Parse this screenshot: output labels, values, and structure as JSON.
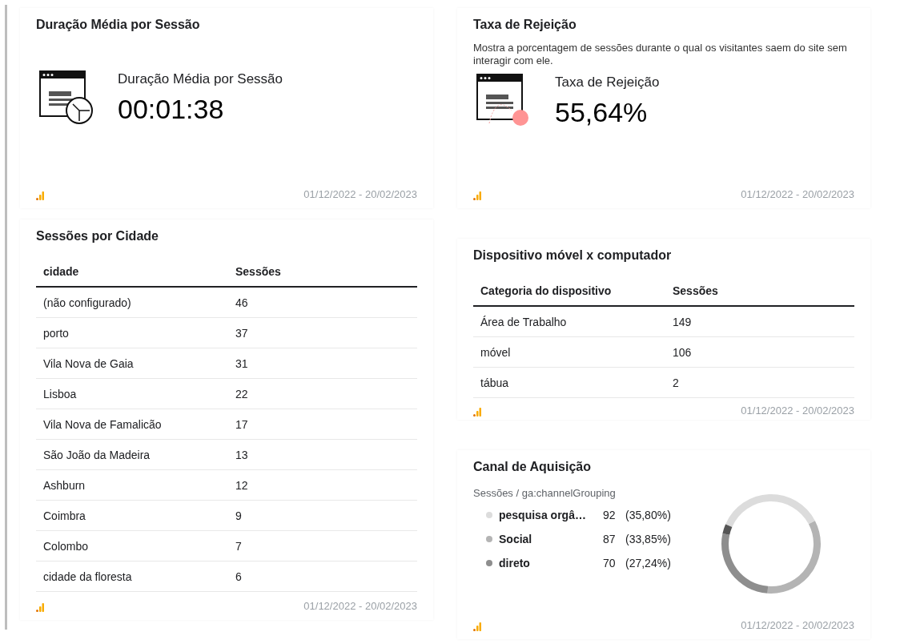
{
  "scorecards": [
    {
      "kind": "clock",
      "title": "Duração Média por Sessão",
      "label": "Duração Média por Sessão",
      "value": "00:01:38",
      "date_range": "01/12/2022 - 20/02/2023"
    },
    {
      "kind": "bounce",
      "title": "Taxa de Rejeição",
      "description": "Mostra a porcentagem de sessões durante o qual os visitantes saem do site sem interagir com ele.",
      "label": "Taxa de Rejeição",
      "value": "55,64%",
      "date_range": "01/12/2022 - 20/02/2023"
    }
  ],
  "city_table": {
    "title": "Sessões por Cidade",
    "columns": [
      "cidade",
      "Sessões"
    ],
    "rows": [
      [
        "(não configurado)",
        "46"
      ],
      [
        "porto",
        "37"
      ],
      [
        "Vila Nova de Gaia",
        "31"
      ],
      [
        "Lisboa",
        "22"
      ],
      [
        "Vila Nova de Famalicão",
        "17"
      ],
      [
        "São João da Madeira",
        "13"
      ],
      [
        "Ashburn",
        "12"
      ],
      [
        "Coimbra",
        "9"
      ],
      [
        "Colombo",
        "7"
      ],
      [
        "cidade da floresta",
        "6"
      ]
    ],
    "date_range": "01/12/2022 - 20/02/2023"
  },
  "device_table": {
    "title": "Dispositivo móvel x computador",
    "columns": [
      "Categoria do dispositivo",
      "Sessões"
    ],
    "rows": [
      [
        "Área de Trabalho",
        "149"
      ],
      [
        "móvel",
        "106"
      ],
      [
        "tábua",
        "2"
      ]
    ],
    "date_range": "01/12/2022 - 20/02/2023"
  },
  "channel_card": {
    "title": "Canal de Aquisição",
    "subtitle": "Sessões / ga:channelGrouping",
    "legend": [
      {
        "value": "92",
        "percent": "(35,80%)",
        "color": "#dcdcdc"
      },
      {
        "value": "87",
        "percent": "(33,85%)",
        "color": "#b4b4b4"
      },
      {
        "value": "70",
        "percent": "(27,24%)",
        "color": "#8e8e8e"
      }
    ],
    "chart_data": {
      "type": "donut",
      "categories": [
        "pesquisa orgâ…",
        "Social",
        "direto",
        null
      ],
      "series": [
        {
          "values": [
            35.8,
            33.85,
            27.24,
            3.11
          ]
        }
      ]
    },
    "date_range": "01/12/2022 - 20/02/2023"
  }
}
